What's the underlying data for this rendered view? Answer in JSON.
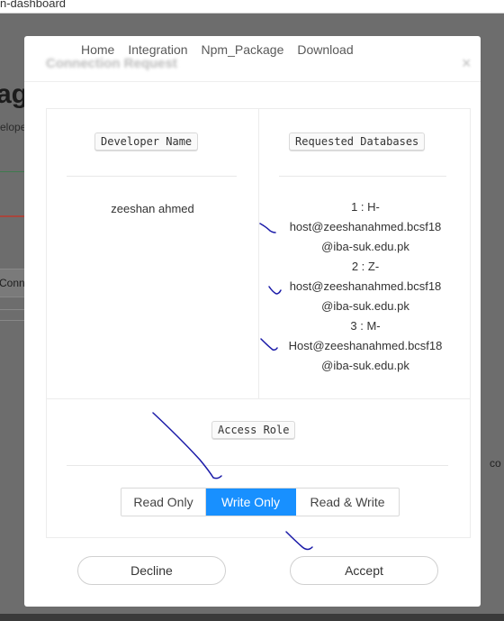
{
  "browser": {
    "url_fragment": "n-dashboard"
  },
  "background": {
    "title_fragment": "ag",
    "subtitle_fragment": "elope",
    "conn_fragment": "Conn",
    "right_fragment": "co"
  },
  "nav": {
    "items": [
      "Home",
      "Integration",
      "Npm_Package",
      "Download"
    ]
  },
  "modal": {
    "title": "Connection Request",
    "close_glyph": "×",
    "developer_label": "Developer Name",
    "databases_label": "Requested Databases",
    "developer_name": "zeeshan ahmed",
    "databases": [
      "1 : H-",
      "host@zeeshanahmed.bcsf18",
      "@iba-suk.edu.pk",
      "2 : Z-",
      "host@zeeshanahmed.bcsf18",
      "@iba-suk.edu.pk",
      "3 : M-",
      "Host@zeeshanahmed.bcsf18",
      "@iba-suk.edu.pk"
    ],
    "access_role_label": "Access Role",
    "roles": [
      "Read Only",
      "Write Only",
      "Read & Write"
    ],
    "selected_role": "Write Only",
    "decline_label": "Decline",
    "accept_label": "Accept"
  },
  "colors": {
    "selected": "#1890ff",
    "annotation": "#1a1aa8"
  }
}
